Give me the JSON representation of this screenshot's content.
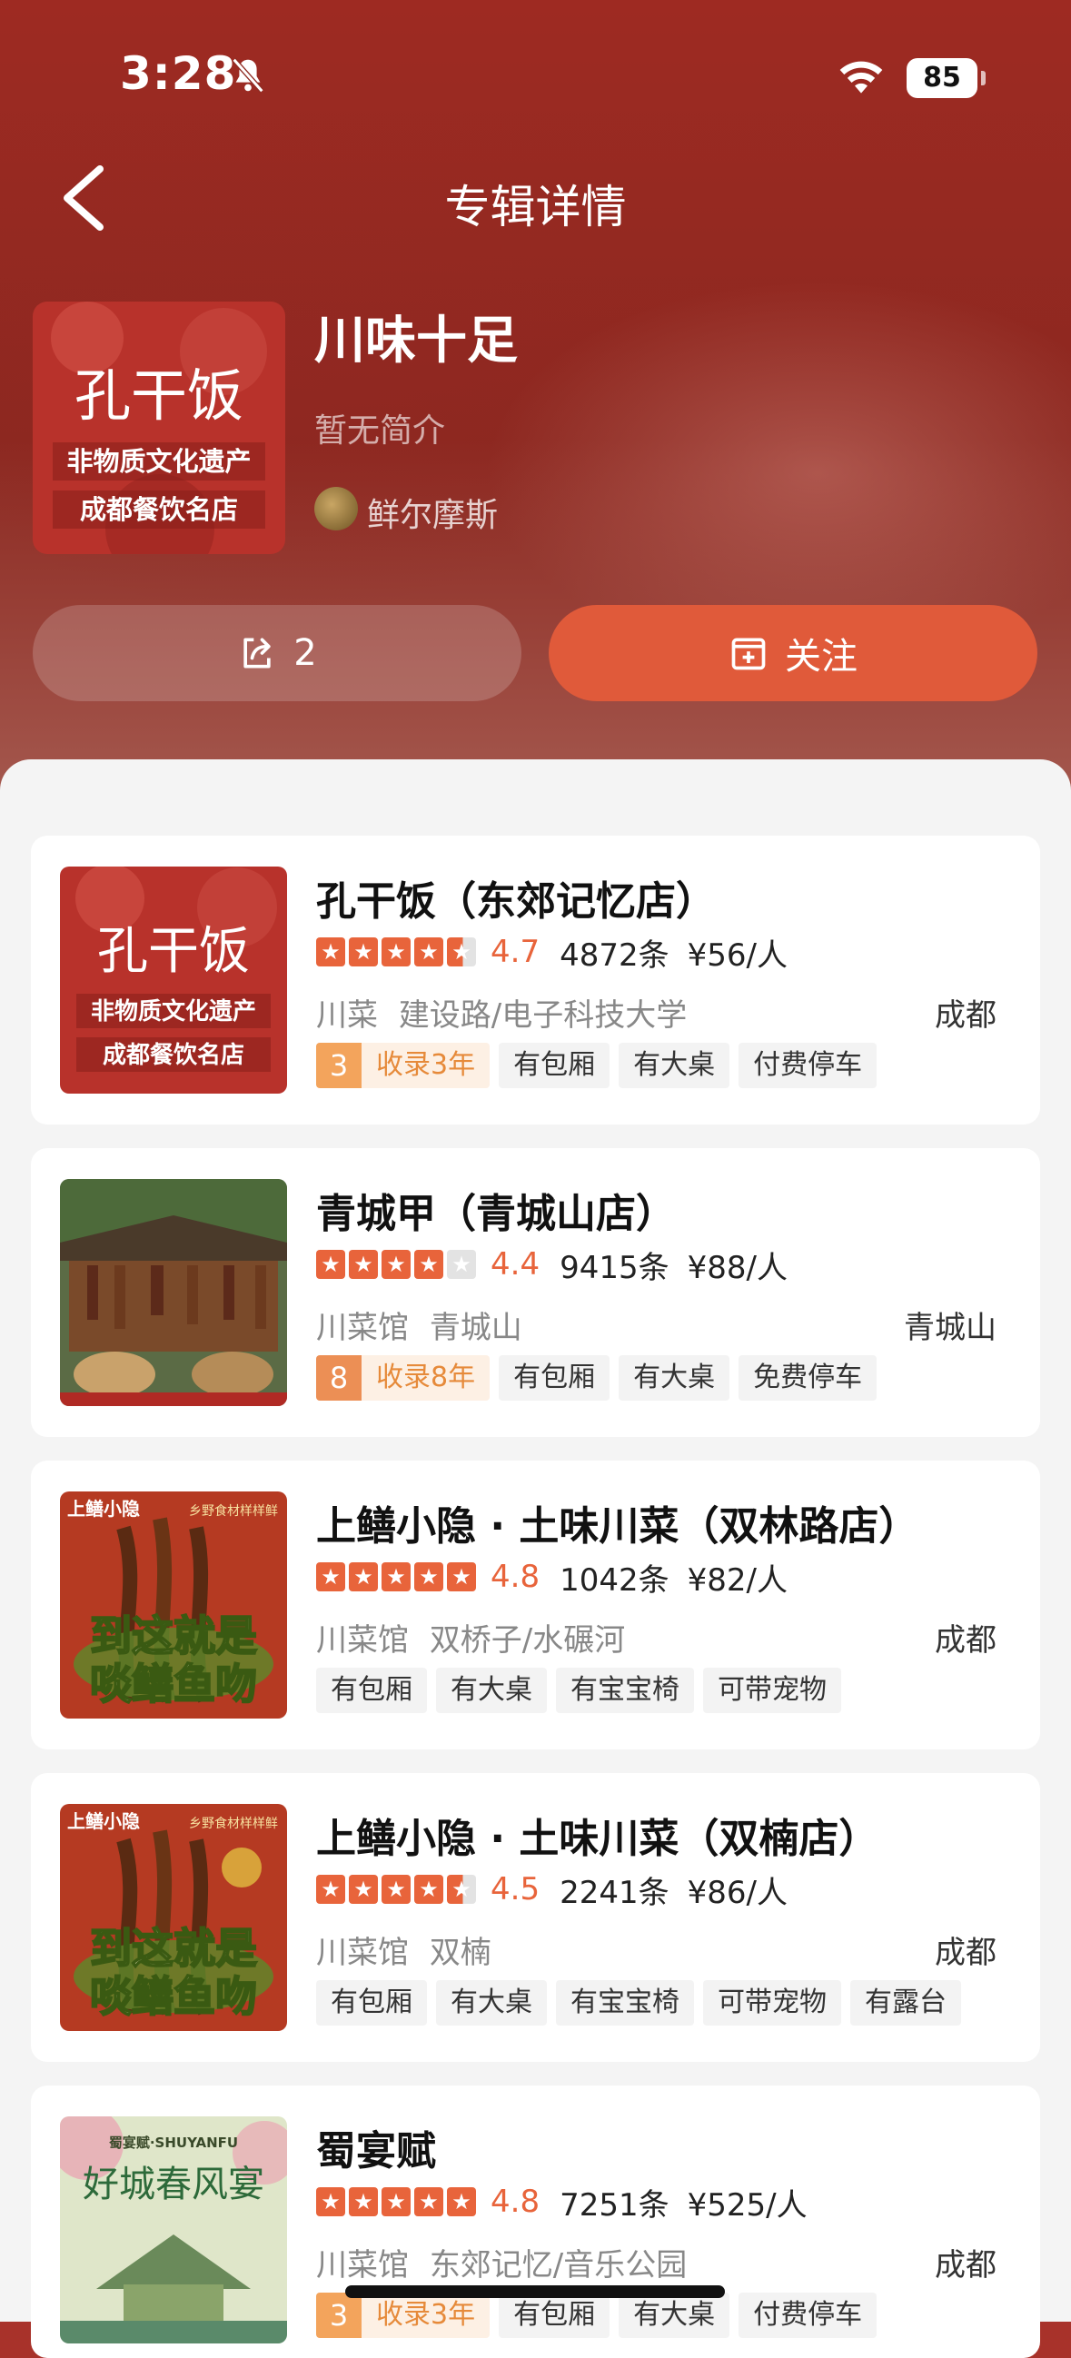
{
  "status_bar": {
    "time": "3:28",
    "battery": "85"
  },
  "header": {
    "title": "专辑详情"
  },
  "album": {
    "name": "川味十足",
    "description": "暂无简介",
    "author": "鲜尔摩斯",
    "share_count": "2",
    "follow_label": "关注",
    "cover_text": [
      "孔干饭",
      "非物质文化遗产",
      "成都餐饮名店"
    ]
  },
  "restaurants": [
    {
      "name": "孔干饭（东郊记忆店）",
      "rating": 4.7,
      "score": "4.7",
      "reviews": "4872条",
      "price": "¥56/人",
      "category": "川菜",
      "area": "建设路/电子科技大学",
      "city": "成都",
      "badge_num": "3",
      "badge_label": "收录3年",
      "tags": [
        "有包厢",
        "有大桌",
        "付费停车"
      ],
      "thumb_text": [
        "孔干饭",
        "非物质文化遗产",
        "成都餐饮名店"
      ]
    },
    {
      "name": "青城甲（青城山店）",
      "rating": 4.4,
      "score": "4.4",
      "reviews": "9415条",
      "price": "¥88/人",
      "category": "川菜馆",
      "area": "青城山",
      "city": "青城山",
      "badge_num": "8",
      "badge_label": "收录8年",
      "tags": [
        "有包厢",
        "有大桌",
        "免费停车"
      ]
    },
    {
      "name": "上鳝小隐 · 土味川菜（双林路店）",
      "rating": 4.8,
      "score": "4.8",
      "reviews": "1042条",
      "price": "¥82/人",
      "category": "川菜馆",
      "area": "双桥子/水碾河",
      "city": "成都",
      "tags": [
        "有包厢",
        "有大桌",
        "有宝宝椅",
        "可带宠物"
      ],
      "thumb_text": [
        "上鳝小隐",
        "乡野食材样样鲜",
        "到这就是",
        "啖鳝鱼吻"
      ]
    },
    {
      "name": "上鳝小隐 · 土味川菜（双楠店）",
      "rating": 4.5,
      "score": "4.5",
      "reviews": "2241条",
      "price": "¥86/人",
      "category": "川菜馆",
      "area": "双楠",
      "city": "成都",
      "tags": [
        "有包厢",
        "有大桌",
        "有宝宝椅",
        "可带宠物",
        "有露台"
      ],
      "thumb_text": [
        "上鳝小隐",
        "乡野食材样样鲜",
        "到这就是",
        "啖鳝鱼吻"
      ]
    },
    {
      "name": "蜀宴赋",
      "rating": 4.8,
      "score": "4.8",
      "reviews": "7251条",
      "price": "¥525/人",
      "category": "川菜馆",
      "area": "东郊记忆/音乐公园",
      "city": "成都",
      "badge_num": "3",
      "badge_label": "收录3年",
      "tags": [
        "有包厢",
        "有大桌",
        "付费停车"
      ],
      "thumb_text": [
        "蜀宴赋·SHUYANFU",
        "好城春风宴"
      ]
    }
  ],
  "colors": {
    "accent": "#e05a3a",
    "star": "#e8643b",
    "hero": "#9e2a22"
  }
}
